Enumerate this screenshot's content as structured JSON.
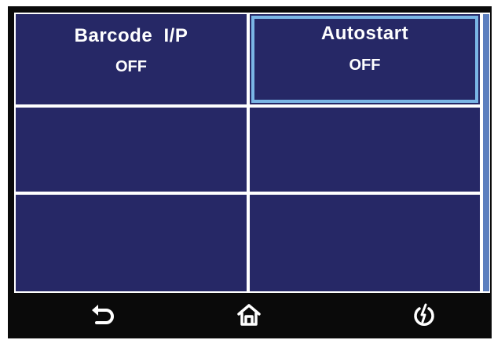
{
  "settings_grid": {
    "cells": [
      {
        "label": "Barcode  I/P",
        "value": "OFF"
      },
      {
        "label": "Autostart",
        "value": "OFF"
      },
      {
        "label": "",
        "value": ""
      },
      {
        "label": "",
        "value": ""
      },
      {
        "label": "",
        "value": ""
      },
      {
        "label": "",
        "value": ""
      }
    ]
  },
  "bottom_bar": {
    "icons": [
      "back-icon",
      "home-icon",
      "power-icon"
    ]
  },
  "colors": {
    "cell_background": "#262866",
    "grid_lines": "#ffffff",
    "selection_border": "#7ab6e6",
    "scrollbar_thumb": "#5c7fbf",
    "bar_background": "#0a0a0a"
  }
}
